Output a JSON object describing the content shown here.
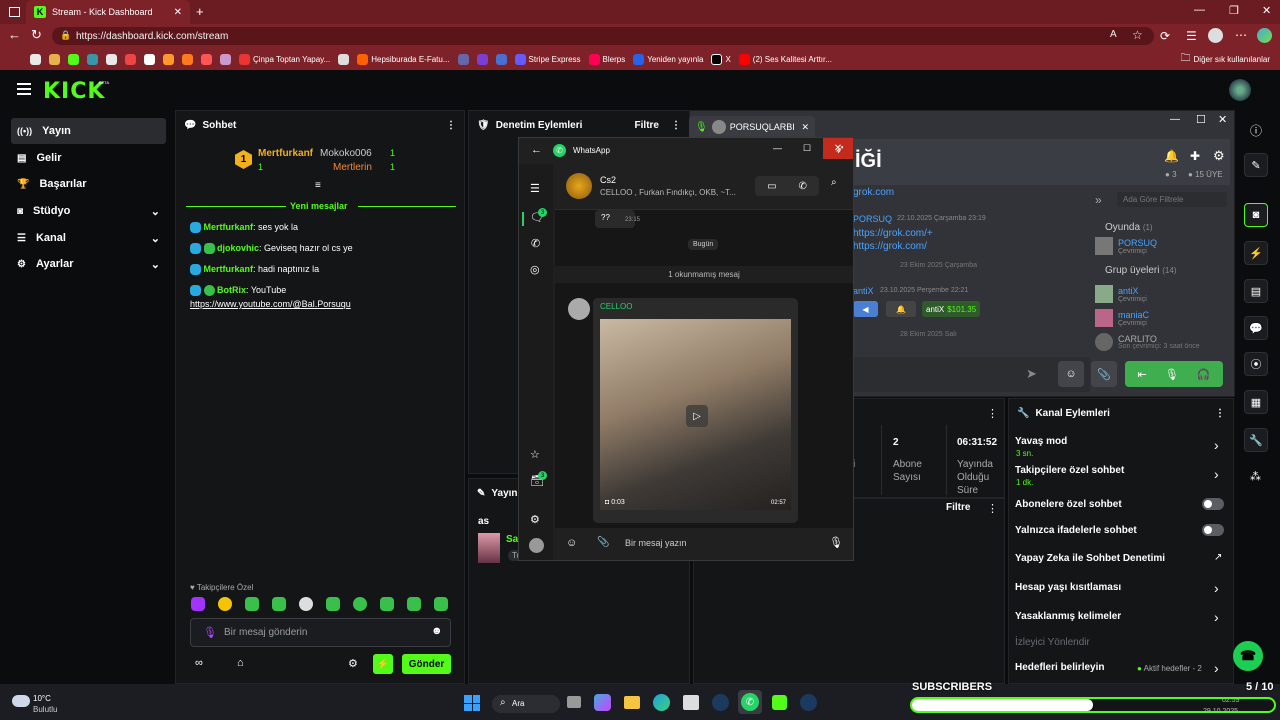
{
  "browser": {
    "tab_title": "Stream - Kick Dashboard",
    "url": "https://dashboard.kick.com/stream",
    "bookmarks": [
      "Çinpa Toptan Yapay...",
      "Hepsiburada E-Fatu...",
      "Stripe Express",
      "Blerps",
      "Yeniden yayınla",
      "X",
      "(2) Ses Kalitesi Arttır..."
    ],
    "other_bookmarks": "Diğer sık kullanılanlar"
  },
  "kick": {
    "logo": "KICK",
    "logo_badge": "BETA",
    "nav": [
      {
        "label": "Yayın"
      },
      {
        "label": "Gelir"
      },
      {
        "label": "Başarılar"
      },
      {
        "label": "Stüdyo"
      },
      {
        "label": "Kanal"
      },
      {
        "label": "Ayarlar"
      }
    ]
  },
  "chat": {
    "title": "Sohbet",
    "leader_1_name": "Mertfurkanf",
    "leader_1_count": "1",
    "leader_1_sub": "1",
    "leader_2_name": "Mokoko006",
    "leader_2_count": "1",
    "leader_3_name": "Mertlerin",
    "leader_3_count": "1",
    "new_messages": "Yeni mesajlar",
    "messages": [
      {
        "user": "Mertfurkanf",
        "text": ": ses yok la"
      },
      {
        "user": "djokovhic",
        "text": ": Geviseq hazır ol cs ye"
      },
      {
        "user": "Mertfurkanf",
        "text": ": hadi naptınız la"
      },
      {
        "user": "BotRix",
        "text": ": YouTube",
        "link": "https://www.youtube.com/@Bal.Porsuqu"
      }
    ],
    "followers_only": "Takipçilere Özel",
    "input_placeholder": "Bir mesaj gönderin",
    "send_label": "Gönder"
  },
  "moderation": {
    "title": "Denetim Eylemleri",
    "filter": "Filtre"
  },
  "stats": {
    "partial_label": "çi",
    "subs_value": "2",
    "subs_label": "Abone Sayısı",
    "uptime_value": "06:31:52",
    "uptime_label": "Yayında Olduğu Süre"
  },
  "filter2": "Filtre",
  "stream_panel": {
    "title": "Yayın b",
    "item": "as",
    "user": "Sad",
    "user_sub": "Tu"
  },
  "discord": {
    "tab_label": "PORSUQLARBI",
    "title": "İĞİ",
    "online_count": "3",
    "member_count": "15 ÜYE",
    "link1": "grok.com",
    "msg_user": "PORSUQ",
    "msg_time": "22.10.2025 Çarşamba 23:19",
    "msg_link1": "https://grok.com/+",
    "msg_link2": "https://grok.com/",
    "date_sep1": "23 Ekim 2025 Çarşamba",
    "msg_user2": "antiX",
    "msg_time2": "23.10.2025 Perşembe 22:21",
    "badge_name": "antiX",
    "badge_amount": "$101.35",
    "date_sep2": "28 Ekim 2025 Salı",
    "search_placeholder": "Ada Göre Filtrele",
    "ingame": "Oyunda",
    "ingame_count": "(1)",
    "m1": "PORSUQ",
    "m1_status": "Çevrimiçi",
    "members": "Grup üyeleri",
    "members_count": "(14)",
    "m2": "antiX",
    "m2_status": "Çevrimiçi",
    "m3": "maniaC",
    "m3_status": "Çevrimiçi",
    "m4": "CARLITO",
    "m4_status": "Son çevrimiçi: 3 saat önce"
  },
  "actions": {
    "title": "Kanal Eylemleri",
    "slow_mode": "Yavaş mod",
    "slow_value": "3 sn.",
    "followers_chat": "Takipçilere özel sohbet",
    "followers_value": "1 dk.",
    "subs_chat": "Abonelere özel sohbet",
    "emotes_chat": "Yalnızca ifadelerle sohbet",
    "ai_mod": "Yapay Zeka ile Sohbet Denetimi",
    "age": "Hesap yaşı kısıtlaması",
    "banned_words": "Yasaklanmış kelimeler",
    "viewer_redirect": "İzleyici Yönlendir",
    "goals": "Hedefleri belirleyin",
    "goals_status": "Aktif hedefler - 2"
  },
  "whatsapp": {
    "title": "WhatsApp",
    "chat_name": "Cs2",
    "chat_members": "CELLOO , Furkan Fındıkçı, OKB, ~T...",
    "msg1": "??",
    "msg1_time": "23:15",
    "day": "Bugün",
    "unread": "1 okunmamış mesaj",
    "sender": "CELLOO",
    "video_duration": "0:03",
    "video_time": "02:57",
    "input_placeholder": "Bir mesaj yazın",
    "badge1": "3",
    "badge2": "3"
  },
  "overlay": {
    "label": "SUBSCRIBERS",
    "count": "5 / 10"
  },
  "taskbar": {
    "weather_temp": "10°C",
    "weather_desc": "Bulutlu",
    "search": "Ara",
    "time": "02:59",
    "date": "29.10.2025"
  },
  "colors": {
    "kick_green": "#53fc18",
    "browser_red": "#7e2229"
  }
}
